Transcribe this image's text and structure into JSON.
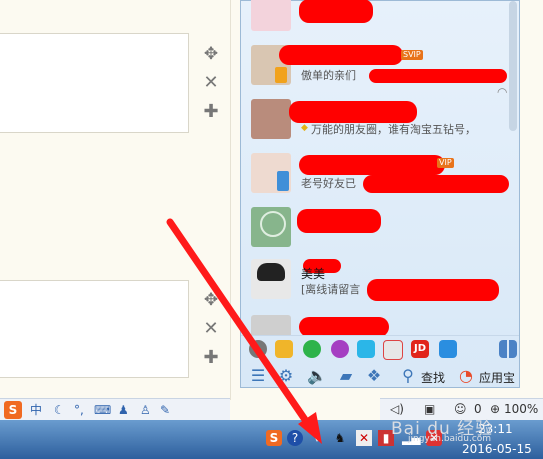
{
  "tools": {
    "move_icon": "move-icon",
    "close_icon": "close-icon",
    "add_icon": "plus-icon"
  },
  "contacts": [
    {
      "name": "",
      "status": "",
      "vip": ""
    },
    {
      "name": "",
      "status": "傲单的亲们",
      "vip": "SVIP"
    },
    {
      "name": "",
      "status": "万能的朋友圈，谁有淘宝五钻号，",
      "vip": ""
    },
    {
      "name": "",
      "status": "老号好友已",
      "vip": "VIP"
    },
    {
      "name": "",
      "status": "",
      "vip": ""
    },
    {
      "name": "美美",
      "status": "[离线请留言",
      "vip": ""
    },
    {
      "name": "",
      "status": "",
      "vip": ""
    }
  ],
  "panel_bottom": {
    "search_label": "查找",
    "appstore_label": "应用宝",
    "jd_label": "JD"
  },
  "ime": {
    "logo": "S",
    "mode": "中",
    "items": [
      "moon-icon",
      "punctuation-icon",
      "keyboard-icon",
      "user-icon",
      "shirt-icon",
      "wrench-icon"
    ]
  },
  "status_strip": {
    "zoom": "100%",
    "count": "0"
  },
  "taskbar": {
    "time": "23:11",
    "date": "2016-05-15"
  },
  "watermark": {
    "main": "Bai du 经验",
    "sub": "jingyan.baidu.com"
  },
  "colors": {
    "accent_red": "#ff0000",
    "taskbar_top": "#6a9ccf",
    "taskbar_bottom": "#2d5f9d",
    "panel_bg": "#e7f1fb"
  }
}
